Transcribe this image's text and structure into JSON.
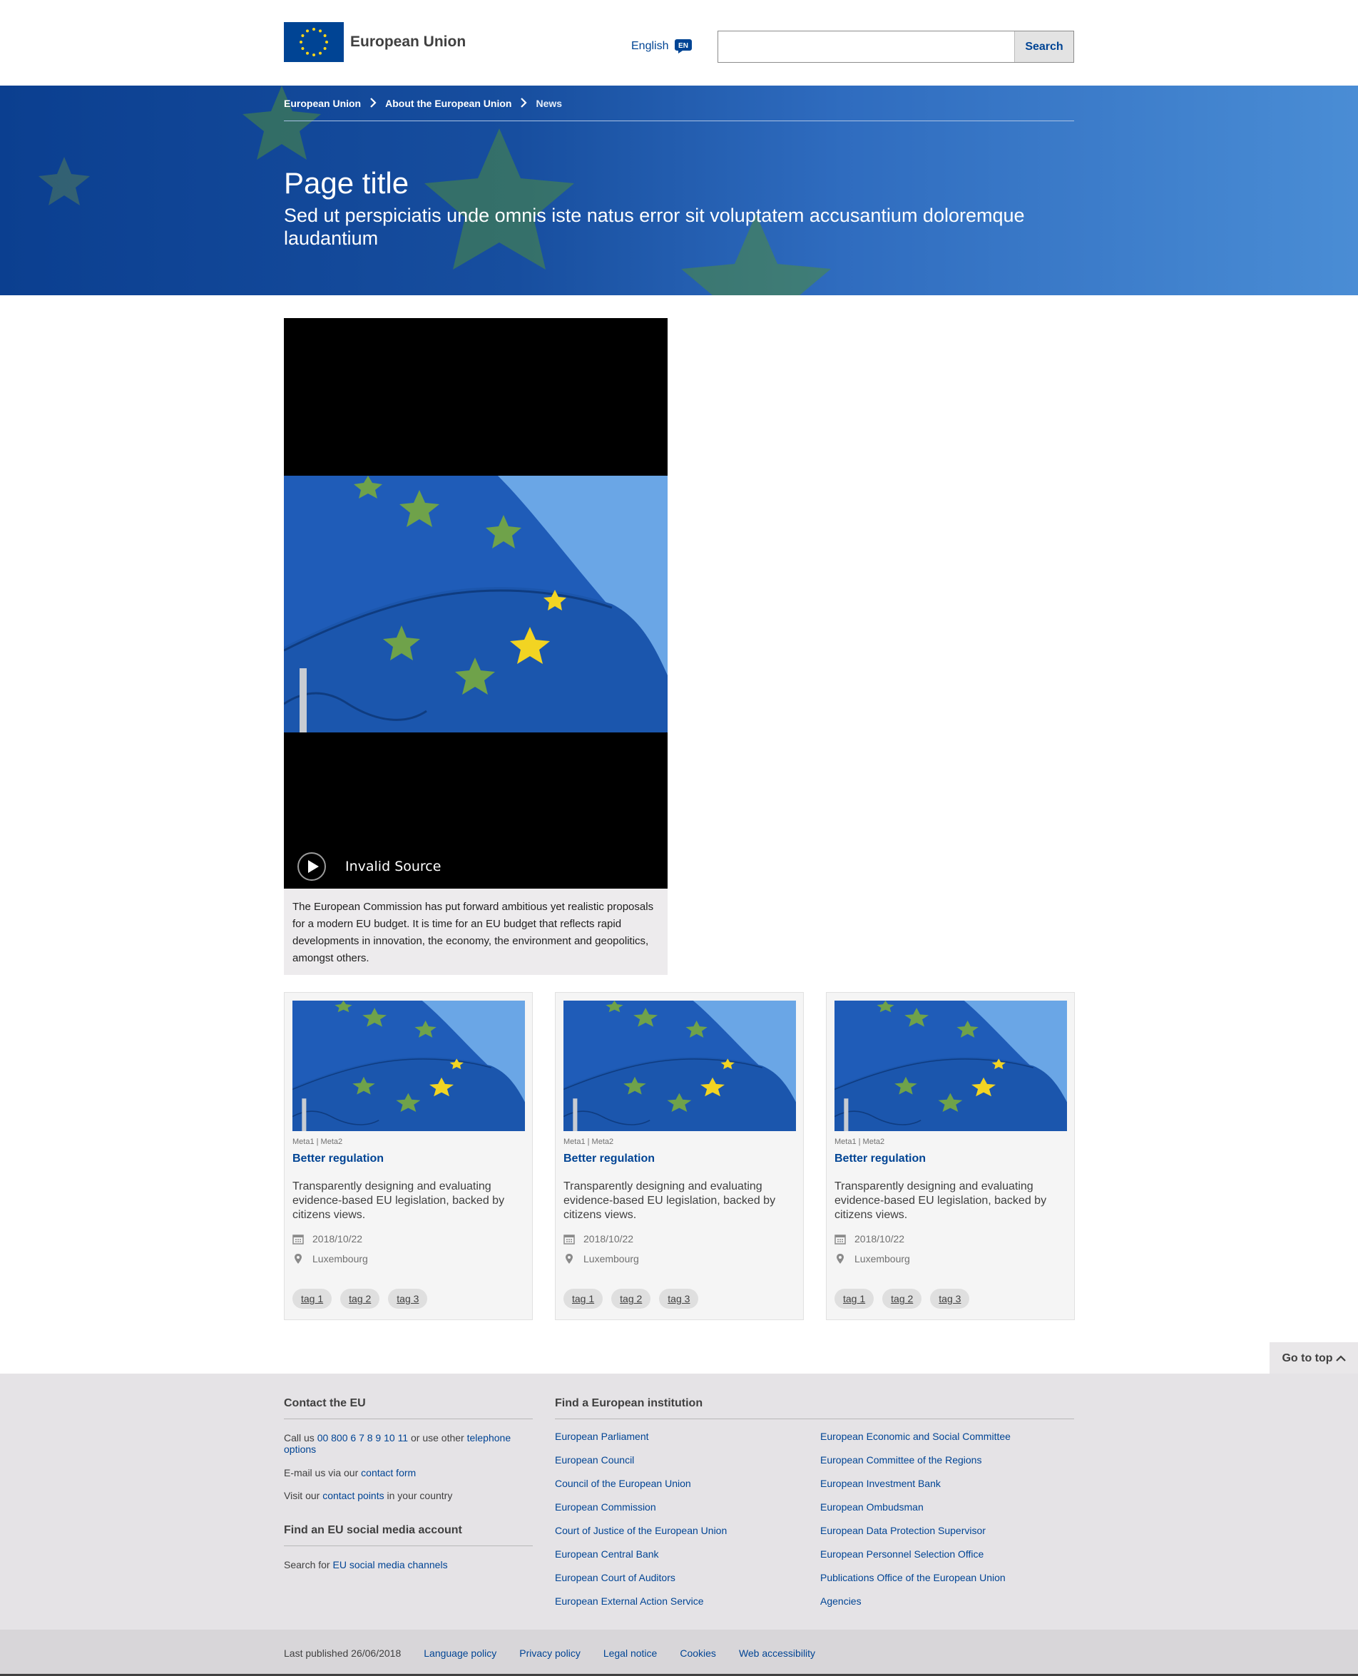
{
  "header": {
    "logo_text": "European Union",
    "language": "English",
    "language_code": "EN",
    "search_placeholder": "",
    "search_button": "Search"
  },
  "breadcrumb": [
    "European Union",
    "About the European Union",
    "News"
  ],
  "hero": {
    "title": "Page title",
    "subtitle": "Sed ut perspiciatis unde omnis iste natus error sit voluptatem accusantium doloremque laudantium"
  },
  "video": {
    "error": "Invalid Source",
    "caption": "The European Commission has put forward ambitious yet realistic proposals for a modern EU budget. It is time for an EU budget that reflects rapid developments in innovation, the economy, the environment and geopolitics, amongst others."
  },
  "cards": [
    {
      "meta": "Meta1 | Meta2",
      "title": "Better regulation",
      "description": "Transparently designing and evaluating evidence-based EU legislation, backed by citizens views.",
      "date": "2018/10/22",
      "location": "Luxembourg",
      "tags": [
        "tag 1",
        "tag 2",
        "tag 3"
      ]
    },
    {
      "meta": "Meta1 | Meta2",
      "title": "Better regulation",
      "description": "Transparently designing and evaluating evidence-based EU legislation, backed by citizens views.",
      "date": "2018/10/22",
      "location": "Luxembourg",
      "tags": [
        "tag 1",
        "tag 2",
        "tag 3"
      ]
    },
    {
      "meta": "Meta1 | Meta2",
      "title": "Better regulation",
      "description": "Transparently designing and evaluating evidence-based EU legislation, backed by citizens views.",
      "date": "2018/10/22",
      "location": "Luxembourg",
      "tags": [
        "tag 1",
        "tag 2",
        "tag 3"
      ]
    }
  ],
  "go_to_top": "Go to top",
  "footer": {
    "contact_heading": "Contact the EU",
    "call_prefix": "Call us",
    "call_number": "00 800 6 7 8 9 10 11",
    "call_middle": "or use other",
    "call_link": "telephone options",
    "email_prefix": "E-mail us via our",
    "email_link": "contact form",
    "visit_prefix": "Visit our",
    "visit_link": "contact points",
    "visit_suffix": "in your country",
    "social_heading": "Find an EU social media account",
    "social_prefix": "Search for",
    "social_link": "EU social media channels",
    "institution_heading": "Find a European institution",
    "institutions_left": [
      "European Parliament",
      "European Council",
      "Council of the European Union",
      "European Commission",
      "Court of Justice of the European Union",
      "European Central Bank",
      "European Court of Auditors",
      "European External Action Service"
    ],
    "institutions_right": [
      "European Economic and Social Committee",
      "European Committee of the Regions",
      "European Investment Bank",
      "European Ombudsman",
      "European Data Protection Supervisor",
      "European Personnel Selection Office",
      "Publications Office of the European Union",
      "Agencies"
    ]
  },
  "bottom_bar": {
    "last_published": "Last published 26/06/2018",
    "links": [
      "Language policy",
      "Privacy policy",
      "Legal notice",
      "Cookies",
      "Web accessibility"
    ]
  },
  "colors": {
    "eu_blue": "#004494",
    "eu_yellow": "#ffd617",
    "footer_bg": "#e5e3e6"
  }
}
